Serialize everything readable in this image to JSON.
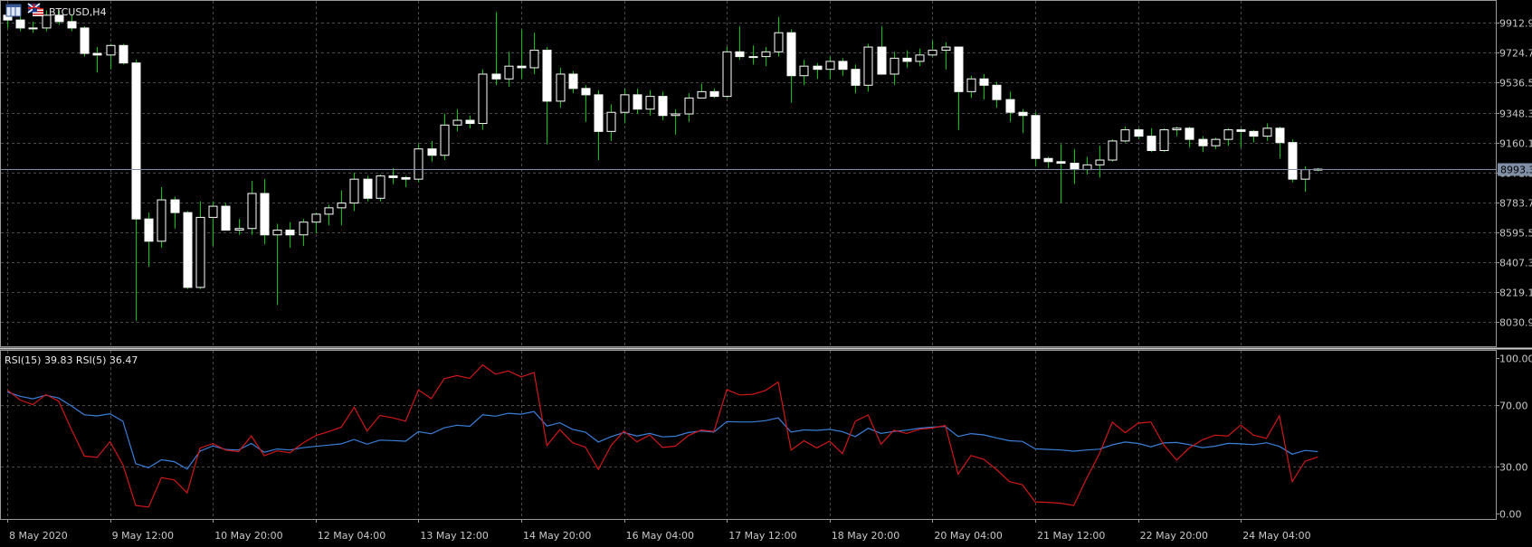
{
  "window": {
    "title": "BTCUSD,H4",
    "icons": [
      "chart-window-icon",
      "uk-us-flag-icon"
    ]
  },
  "colors": {
    "background": "#000000",
    "grid": "#4a4a4a",
    "bull_body": "#000000",
    "bear_body": "#ffffff",
    "candle_border": "#ffffff",
    "wick": "#00c800",
    "rsi15": "#3a7fd9",
    "rsi5": "#d01818",
    "bid_line": "#7f90a6",
    "text": "#c8c8c8"
  },
  "price_panel": {
    "tick_labels": [
      "9912.9",
      "9724.7",
      "9536.5",
      "9348.3",
      "9160.1",
      "8971.9",
      "8783.7",
      "8595.5",
      "8407.3",
      "8219.1",
      "8030.9"
    ],
    "current_price_label": "8993.3",
    "current_price": 8993.3
  },
  "rsi_panel": {
    "label": "RSI(15) 39.83 RSI(5) 36.47",
    "tick_labels": [
      "100.00",
      "70.00",
      "30.00",
      "0.00"
    ]
  },
  "time_axis": {
    "labels": [
      "8 May 2020",
      "9 May 12:00",
      "10 May 20:00",
      "12 May 04:00",
      "13 May 12:00",
      "14 May 20:00",
      "16 May 04:00",
      "17 May 12:00",
      "18 May 20:00",
      "20 May 04:00",
      "21 May 12:00",
      "22 May 20:00",
      "24 May 04:00"
    ]
  },
  "chart_data": [
    {
      "type": "candlestick",
      "title": "BTCUSD,H4",
      "y_ticks": [
        9912.9,
        9724.7,
        9536.5,
        9348.3,
        9160.1,
        8971.9,
        8783.7,
        8595.5,
        8407.3,
        8219.1,
        8030.9
      ],
      "ylim": [
        7880,
        10050
      ],
      "x_labels": [
        "8 May 2020",
        "9 May 12:00",
        "10 May 20:00",
        "12 May 04:00",
        "13 May 12:00",
        "14 May 20:00",
        "16 May 04:00",
        "17 May 12:00",
        "18 May 20:00",
        "20 May 04:00",
        "21 May 12:00",
        "22 May 20:00",
        "24 May 04:00"
      ],
      "grid": true,
      "current_price": 8993.3,
      "ohlc": [
        [
          9960,
          10000,
          9880,
          9930
        ],
        [
          9930,
          9950,
          9860,
          9880
        ],
        [
          9880,
          9920,
          9850,
          9880
        ],
        [
          9880,
          9990,
          9860,
          9960
        ],
        [
          9960,
          9990,
          9900,
          9920
        ],
        [
          9920,
          9960,
          9860,
          9880
        ],
        [
          9880,
          9890,
          9700,
          9720
        ],
        [
          9720,
          9760,
          9600,
          9710
        ],
        [
          9710,
          9780,
          9620,
          9770
        ],
        [
          9770,
          9780,
          9650,
          9660
        ],
        [
          9660,
          9680,
          8040,
          8680
        ],
        [
          8680,
          8720,
          8380,
          8540
        ],
        [
          8540,
          8880,
          8500,
          8800
        ],
        [
          8800,
          8820,
          8620,
          8720
        ],
        [
          8720,
          8730,
          8240,
          8250
        ],
        [
          8250,
          8790,
          8240,
          8690
        ],
        [
          8690,
          8790,
          8510,
          8760
        ],
        [
          8760,
          8780,
          8610,
          8610
        ],
        [
          8610,
          8680,
          8580,
          8620
        ],
        [
          8620,
          8920,
          8580,
          8840
        ],
        [
          8840,
          8930,
          8520,
          8580
        ],
        [
          8580,
          8650,
          8140,
          8610
        ],
        [
          8610,
          8660,
          8500,
          8580
        ],
        [
          8580,
          8680,
          8510,
          8660
        ],
        [
          8660,
          8720,
          8590,
          8710
        ],
        [
          8710,
          8770,
          8640,
          8750
        ],
        [
          8750,
          8860,
          8640,
          8780
        ],
        [
          8780,
          8970,
          8730,
          8930
        ],
        [
          8930,
          8950,
          8790,
          8810
        ],
        [
          8810,
          8960,
          8790,
          8950
        ],
        [
          8950,
          9000,
          8900,
          8940
        ],
        [
          8940,
          8950,
          8880,
          8930
        ],
        [
          8930,
          9150,
          8910,
          9120
        ],
        [
          9120,
          9170,
          9040,
          9080
        ],
        [
          9080,
          9340,
          9050,
          9270
        ],
        [
          9270,
          9370,
          9230,
          9300
        ],
        [
          9300,
          9330,
          9250,
          9280
        ],
        [
          9280,
          9620,
          9240,
          9590
        ],
        [
          9590,
          9980,
          9520,
          9560
        ],
        [
          9560,
          9730,
          9510,
          9640
        ],
        [
          9640,
          9870,
          9560,
          9630
        ],
        [
          9630,
          9850,
          9590,
          9740
        ],
        [
          9740,
          9760,
          9150,
          9420
        ],
        [
          9420,
          9630,
          9380,
          9590
        ],
        [
          9590,
          9610,
          9470,
          9500
        ],
        [
          9500,
          9520,
          9290,
          9460
        ],
        [
          9460,
          9490,
          9050,
          9230
        ],
        [
          9230,
          9400,
          9170,
          9350
        ],
        [
          9350,
          9500,
          9280,
          9460
        ],
        [
          9460,
          9500,
          9340,
          9370
        ],
        [
          9370,
          9490,
          9330,
          9450
        ],
        [
          9450,
          9480,
          9300,
          9330
        ],
        [
          9330,
          9370,
          9210,
          9340
        ],
        [
          9340,
          9470,
          9290,
          9440
        ],
        [
          9440,
          9530,
          9440,
          9480
        ],
        [
          9480,
          9500,
          9440,
          9450
        ],
        [
          9450,
          9760,
          9440,
          9730
        ],
        [
          9730,
          9890,
          9680,
          9700
        ],
        [
          9700,
          9770,
          9650,
          9700
        ],
        [
          9700,
          9760,
          9640,
          9730
        ],
        [
          9730,
          9950,
          9700,
          9850
        ],
        [
          9850,
          9870,
          9410,
          9580
        ],
        [
          9580,
          9680,
          9520,
          9640
        ],
        [
          9640,
          9660,
          9560,
          9620
        ],
        [
          9620,
          9700,
          9560,
          9670
        ],
        [
          9670,
          9690,
          9580,
          9620
        ],
        [
          9620,
          9650,
          9470,
          9520
        ],
        [
          9520,
          9780,
          9480,
          9760
        ],
        [
          9760,
          9890,
          9610,
          9590
        ],
        [
          9590,
          9730,
          9520,
          9690
        ],
        [
          9690,
          9740,
          9630,
          9670
        ],
        [
          9670,
          9750,
          9640,
          9710
        ],
        [
          9710,
          9800,
          9700,
          9740
        ],
        [
          9740,
          9790,
          9620,
          9760
        ],
        [
          9760,
          9760,
          9240,
          9480
        ],
        [
          9480,
          9580,
          9440,
          9560
        ],
        [
          9560,
          9590,
          9430,
          9520
        ],
        [
          9520,
          9540,
          9380,
          9430
        ],
        [
          9430,
          9480,
          9290,
          9350
        ],
        [
          9350,
          9370,
          9220,
          9330
        ],
        [
          9330,
          9350,
          9010,
          9060
        ],
        [
          9060,
          9070,
          9000,
          9040
        ],
        [
          9040,
          9150,
          8780,
          9030
        ],
        [
          9030,
          9120,
          8900,
          8990
        ],
        [
          8990,
          9070,
          8960,
          9020
        ],
        [
          9020,
          9140,
          8940,
          9050
        ],
        [
          9050,
          9180,
          9040,
          9170
        ],
        [
          9170,
          9260,
          9160,
          9240
        ],
        [
          9240,
          9250,
          9180,
          9200
        ],
        [
          9200,
          9250,
          9100,
          9110
        ],
        [
          9110,
          9250,
          9100,
          9240
        ],
        [
          9240,
          9260,
          9200,
          9250
        ],
        [
          9250,
          9260,
          9130,
          9180
        ],
        [
          9180,
          9200,
          9100,
          9140
        ],
        [
          9140,
          9190,
          9120,
          9180
        ],
        [
          9180,
          9250,
          9140,
          9240
        ],
        [
          9240,
          9250,
          9130,
          9230
        ],
        [
          9230,
          9240,
          9160,
          9200
        ],
        [
          9200,
          9280,
          9170,
          9250
        ],
        [
          9250,
          9260,
          9060,
          9160
        ],
        [
          9160,
          9180,
          8910,
          8930
        ],
        [
          8930,
          9010,
          8850,
          8990
        ],
        [
          8990,
          9000,
          8980,
          8993
        ]
      ]
    },
    {
      "type": "line",
      "title": "RSI(15) 39.83 RSI(5) 36.47",
      "ylim": [
        0,
        100
      ],
      "y_ticks": [
        100,
        70,
        30,
        0
      ],
      "series": [
        {
          "name": "RSI(15)",
          "value": 39.83,
          "values": [
            78.2,
            75.4,
            73.8,
            76.1,
            74.3,
            69.2,
            63.5,
            62.8,
            64.2,
            59.3,
            32.1,
            29.5,
            34.6,
            33.4,
            28.6,
            40.1,
            43.5,
            41.2,
            40.9,
            45.1,
            39.4,
            41.5,
            40.9,
            42.3,
            43.2,
            44.0,
            44.8,
            47.6,
            44.6,
            47.2,
            46.9,
            46.5,
            52.7,
            51.3,
            55.1,
            56.8,
            56.1,
            63.5,
            62.6,
            64.5,
            63.9,
            65.6,
            56.3,
            58.4,
            54.1,
            52.3,
            46.0,
            49.5,
            52.1,
            49.9,
            51.5,
            49.3,
            49.7,
            52.1,
            53.1,
            52.4,
            59.1,
            58.9,
            58.9,
            59.7,
            61.5,
            52.4,
            53.8,
            53.5,
            54.1,
            52.7,
            49.5,
            54.8,
            51.5,
            52.8,
            53.6,
            54.9,
            55.6,
            56.0,
            49.6,
            51.4,
            50.6,
            48.6,
            46.8,
            46.4,
            41.6,
            41.2,
            40.9,
            40.1,
            40.9,
            41.4,
            44.2,
            46.0,
            45.1,
            42.9,
            45.4,
            45.7,
            44.3,
            42.3,
            43.3,
            45.1,
            44.8,
            44.3,
            45.5,
            43.2,
            38.2,
            40.6,
            39.83
          ]
        },
        {
          "name": "RSI(5)",
          "value": 36.47,
          "values": [
            79.5,
            73.0,
            70.0,
            76.5,
            72.3,
            54.0,
            37.0,
            36.1,
            46.3,
            31.4,
            5.2,
            4.1,
            23.1,
            21.6,
            13.3,
            42.1,
            45.0,
            40.8,
            39.8,
            49.9,
            37.2,
            40.3,
            39.1,
            45.3,
            50.1,
            52.7,
            55.5,
            68.4,
            53.1,
            63.1,
            61.5,
            59.4,
            79.5,
            73.9,
            86.7,
            88.7,
            86.9,
            95.6,
            89.6,
            91.7,
            87.9,
            90.7,
            43.7,
            53.9,
            45.5,
            42.7,
            28.4,
            43.8,
            53.1,
            46.1,
            50.5,
            42.5,
            43.4,
            50.1,
            53.7,
            52.8,
            79.7,
            76.3,
            76.7,
            79.1,
            84.6,
            40.8,
            46.8,
            42.2,
            46.5,
            38.5,
            59.4,
            63.4,
            44.6,
            53.6,
            51.5,
            54.2,
            55.0,
            56.6,
            25.3,
            37.3,
            34.9,
            28.2,
            20.5,
            18.5,
            7.5,
            7.2,
            6.6,
            5.2,
            22.6,
            38.5,
            58.8,
            52.0,
            58.1,
            58.9,
            44.2,
            34.4,
            42.2,
            47.4,
            50.4,
            49.9,
            56.9,
            50.3,
            48.4,
            62.9,
            20.5,
            33.6,
            36.47
          ]
        }
      ]
    }
  ]
}
